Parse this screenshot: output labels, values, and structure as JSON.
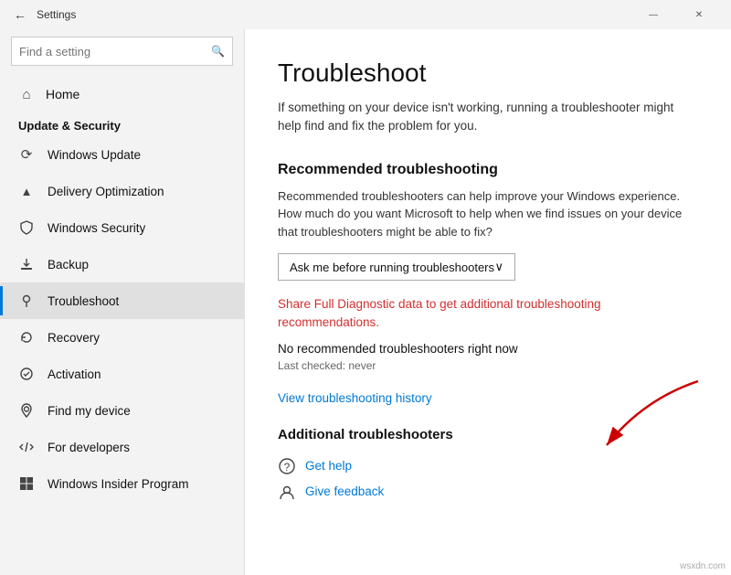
{
  "titlebar": {
    "back_icon": "←",
    "title": "Settings",
    "minimize_label": "—",
    "close_label": "✕"
  },
  "sidebar": {
    "search_placeholder": "Find a setting",
    "search_icon": "🔍",
    "home_label": "Home",
    "section_label": "Update & Security",
    "items": [
      {
        "id": "windows-update",
        "label": "Windows Update",
        "icon": "⟳"
      },
      {
        "id": "delivery-optimization",
        "label": "Delivery Optimization",
        "icon": "⬆"
      },
      {
        "id": "windows-security",
        "label": "Windows Security",
        "icon": "🛡"
      },
      {
        "id": "backup",
        "label": "Backup",
        "icon": "↑"
      },
      {
        "id": "troubleshoot",
        "label": "Troubleshoot",
        "icon": "👤"
      },
      {
        "id": "recovery",
        "label": "Recovery",
        "icon": "↺"
      },
      {
        "id": "activation",
        "label": "Activation",
        "icon": "✓"
      },
      {
        "id": "find-my-device",
        "label": "Find my device",
        "icon": "📍"
      },
      {
        "id": "for-developers",
        "label": "For developers",
        "icon": "💻"
      },
      {
        "id": "windows-insider",
        "label": "Windows Insider Program",
        "icon": "🪟"
      }
    ]
  },
  "main": {
    "title": "Troubleshoot",
    "description": "If something on your device isn't working, running a troubleshooter might help find and fix the problem for you.",
    "recommended_heading": "Recommended troubleshooting",
    "recommended_desc": "Recommended troubleshooters can help improve your Windows experience. How much do you want Microsoft to help when we find issues on your device that troubleshooters might be able to fix?",
    "dropdown_label": "Ask me before running troubleshooters",
    "dropdown_icon": "∨",
    "share_link": "Share Full Diagnostic data to get additional troubleshooting recommendations.",
    "no_troubleshooters": "No recommended troubleshooters right now",
    "last_checked": "Last checked: never",
    "view_history_link": "View troubleshooting history",
    "additional_heading": "Additional troubleshooters",
    "get_help_label": "Get help",
    "give_feedback_label": "Give feedback"
  },
  "watermark": "wsxdn.com"
}
